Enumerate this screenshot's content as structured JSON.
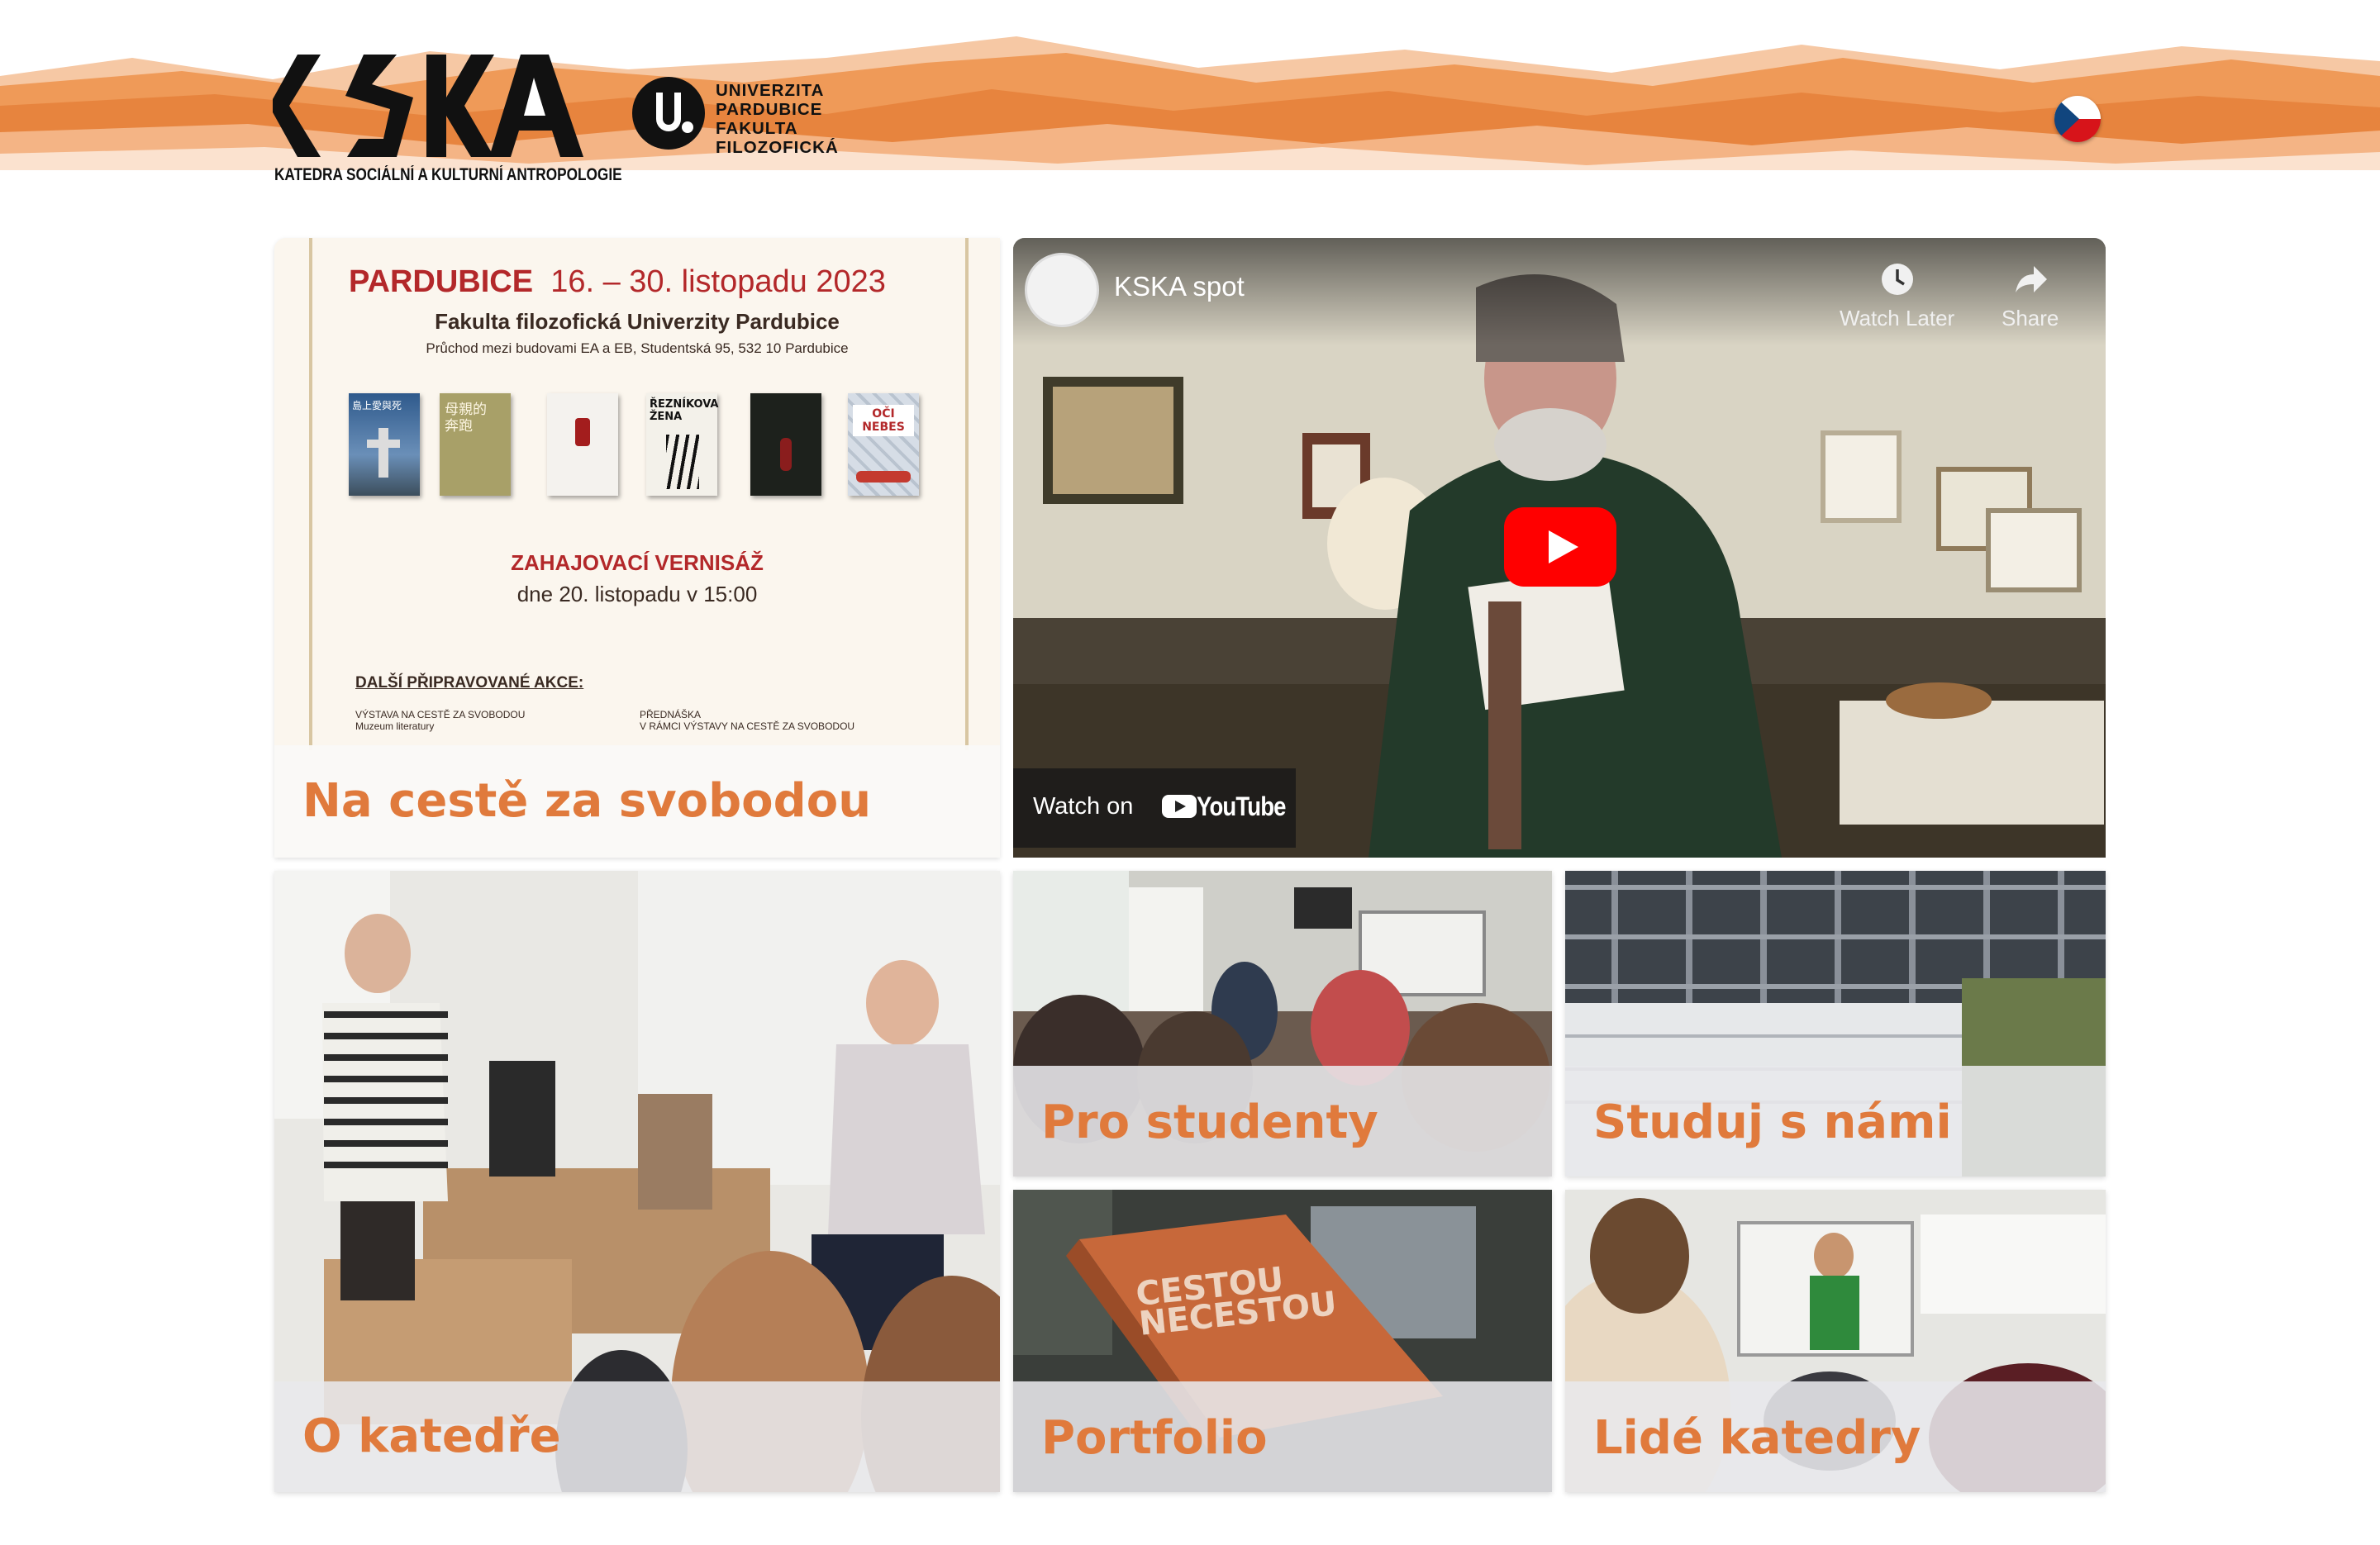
{
  "header": {
    "logo_text": "KSKA",
    "logo_subtitle": "KATEDRA SOCIÁLNÍ A KULTURNÍ ANTROPOLOGIE",
    "university_lines": [
      "UNIVERZITA",
      "PARDUBICE",
      "FAKULTA",
      "FILOZOFICKÁ"
    ],
    "language_flag": "czech-flag-icon",
    "brand_color": "#e8843f"
  },
  "poster": {
    "city": "PARDUBICE",
    "dates": "16. – 30. listopadu 2023",
    "faculty": "Fakulta filozofická Univerzity Pardubice",
    "address": "Průchod mezi budovami EA a EB, Studentská 95, 532 10 Pardubice",
    "opening_title": "ZAHAJOVACÍ VERNISÁŽ",
    "opening_date": "dne 20. listopadu v 15:00",
    "more_events_title": "DALŠÍ PŘIPRAVOVANÉ AKCE:",
    "event1_line1": "VÝSTAVA NA CESTĚ ZA SVOBODOU",
    "event1_line2": "Muzeum literatury",
    "event2_line1": "PŘEDNÁŠKA",
    "event2_line2": "V RÁMCI VÝSTAVY NA CESTĚ ZA SVOBODOU",
    "book_titles": [
      "島上愛與死",
      "母親的奔跑",
      "",
      "ŘEZNÍKOVA ŽENA",
      "",
      "OČI NEBES"
    ],
    "label": "Na cestě za svobodou"
  },
  "video": {
    "title": "KSKA spot",
    "watch_later": "Watch Later",
    "share": "Share",
    "watch_on": "Watch on",
    "youtube": "YouTube"
  },
  "tiles": {
    "about": "O katedře",
    "students": "Pro studenty",
    "study": "Studuj s námi",
    "portfolio": "Portfolio",
    "people": "Lidé katedry",
    "portfolio_book_title": "CESTOU NECESTOU"
  }
}
